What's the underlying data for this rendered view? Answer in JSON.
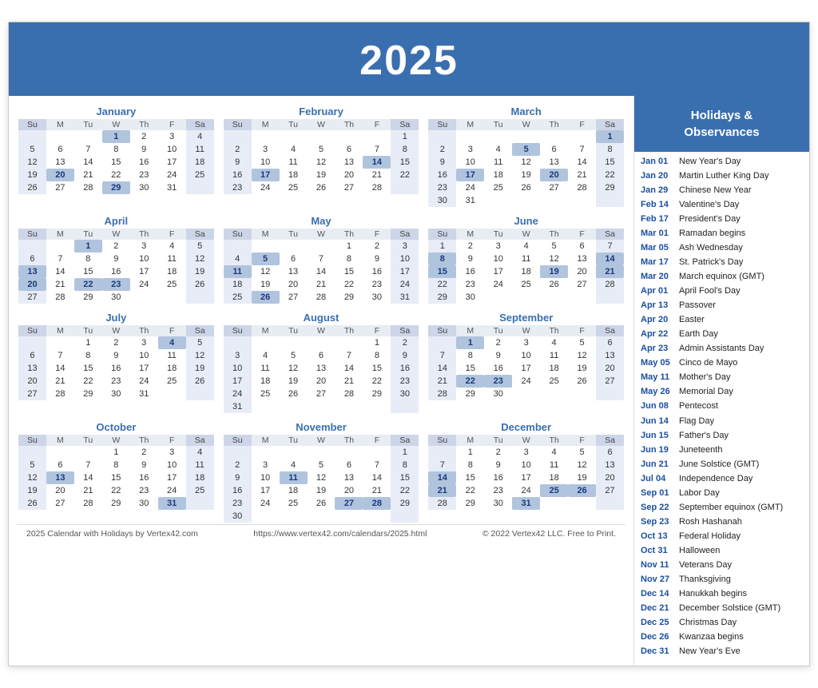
{
  "title": "2025",
  "sidebar": {
    "header": "Holidays &\nObservances",
    "items": [
      {
        "date": "Jan 01",
        "name": "New Year's Day"
      },
      {
        "date": "Jan 20",
        "name": "Martin Luther King Day"
      },
      {
        "date": "Jan 29",
        "name": "Chinese New Year"
      },
      {
        "date": "Feb 14",
        "name": "Valentine's Day"
      },
      {
        "date": "Feb 17",
        "name": "President's Day"
      },
      {
        "date": "Mar 01",
        "name": "Ramadan begins"
      },
      {
        "date": "Mar 05",
        "name": "Ash Wednesday"
      },
      {
        "date": "Mar 17",
        "name": "St. Patrick's Day"
      },
      {
        "date": "Mar 20",
        "name": "March equinox (GMT)"
      },
      {
        "date": "Apr 01",
        "name": "April Fool's Day"
      },
      {
        "date": "Apr 13",
        "name": "Passover"
      },
      {
        "date": "Apr 20",
        "name": "Easter"
      },
      {
        "date": "Apr 22",
        "name": "Earth Day"
      },
      {
        "date": "Apr 23",
        "name": "Admin Assistants Day"
      },
      {
        "date": "May 05",
        "name": "Cinco de Mayo"
      },
      {
        "date": "May 11",
        "name": "Mother's Day"
      },
      {
        "date": "May 26",
        "name": "Memorial Day"
      },
      {
        "date": "Jun 08",
        "name": "Pentecost"
      },
      {
        "date": "Jun 14",
        "name": "Flag Day"
      },
      {
        "date": "Jun 15",
        "name": "Father's Day"
      },
      {
        "date": "Jun 19",
        "name": "Juneteenth"
      },
      {
        "date": "Jun 21",
        "name": "June Solstice (GMT)"
      },
      {
        "date": "Jul 04",
        "name": "Independence Day"
      },
      {
        "date": "Sep 01",
        "name": "Labor Day"
      },
      {
        "date": "Sep 22",
        "name": "September equinox (GMT)"
      },
      {
        "date": "Sep 23",
        "name": "Rosh Hashanah"
      },
      {
        "date": "Oct 13",
        "name": "Federal Holiday"
      },
      {
        "date": "Oct 31",
        "name": "Halloween"
      },
      {
        "date": "Nov 11",
        "name": "Veterans Day"
      },
      {
        "date": "Nov 27",
        "name": "Thanksgiving"
      },
      {
        "date": "Dec 14",
        "name": "Hanukkah begins"
      },
      {
        "date": "Dec 21",
        "name": "December Solstice (GMT)"
      },
      {
        "date": "Dec 25",
        "name": "Christmas Day"
      },
      {
        "date": "Dec 26",
        "name": "Kwanzaa begins"
      },
      {
        "date": "Dec 31",
        "name": "New Year's Eve"
      }
    ]
  },
  "footer": {
    "left": "2025 Calendar with Holidays by Vertex42.com",
    "center": "https://www.vertex42.com/calendars/2025.html",
    "right": "© 2022 Vertex42 LLC. Free to Print."
  }
}
